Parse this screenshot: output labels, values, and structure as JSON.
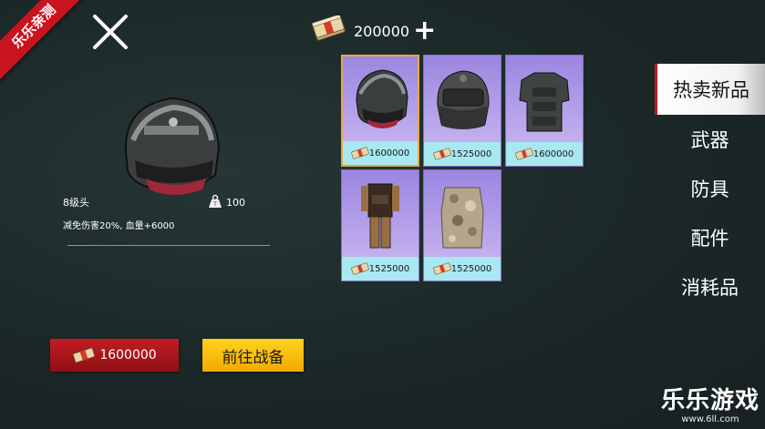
{
  "ribbon": "乐乐亲测",
  "currency": {
    "amount": "200000",
    "plus": "+"
  },
  "selected_item": {
    "name": "8级头",
    "weight": "100",
    "description": "减免伤害20%, 血量+6000"
  },
  "items": [
    {
      "icon": "helmet-level8-icon",
      "price": "1600000"
    },
    {
      "icon": "helmet-visor-icon",
      "price": "1525000"
    },
    {
      "icon": "armor-vest-dark-icon",
      "price": "1600000"
    },
    {
      "icon": "tactical-suit-icon",
      "price": "1525000"
    },
    {
      "icon": "camo-ghillie-icon",
      "price": "1525000"
    }
  ],
  "tabs": [
    {
      "label": "热卖新品"
    },
    {
      "label": "武器"
    },
    {
      "label": "防具"
    },
    {
      "label": "配件"
    },
    {
      "label": "消耗品"
    }
  ],
  "buy_button": {
    "price": "1600000"
  },
  "go_button": {
    "label": "前往战备"
  },
  "watermark": {
    "title": "乐乐游戏",
    "url": "www.6ll.com"
  },
  "colors": {
    "accent_red": "#c21d23",
    "accent_yellow": "#f2a900",
    "card_purple": "#9a86e0",
    "price_cyan": "#a8e8f0"
  }
}
